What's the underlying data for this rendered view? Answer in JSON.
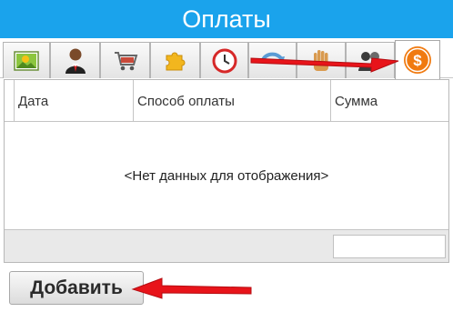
{
  "window": {
    "title": "Оплаты"
  },
  "tabs": [
    {
      "icon": "landscape-picture-icon"
    },
    {
      "icon": "person-icon"
    },
    {
      "icon": "shopping-cart-icon"
    },
    {
      "icon": "puzzle-piece-icon"
    },
    {
      "icon": "clock-icon"
    },
    {
      "icon": "curved-arrow-icon"
    },
    {
      "icon": "hand-icon"
    },
    {
      "icon": "people-icon"
    },
    {
      "icon": "dollar-coin-icon",
      "active": true
    }
  ],
  "grid": {
    "columns": [
      "Дата",
      "Способ оплаты",
      "Сумма"
    ],
    "empty_text": "<Нет данных для отображения>",
    "rows": []
  },
  "actions": {
    "add_label": "Добавить"
  },
  "annotations": {
    "arrow_color": "#e8141a"
  },
  "colors": {
    "title_bar": "#1aa3ec",
    "coin": "#f07a10"
  }
}
